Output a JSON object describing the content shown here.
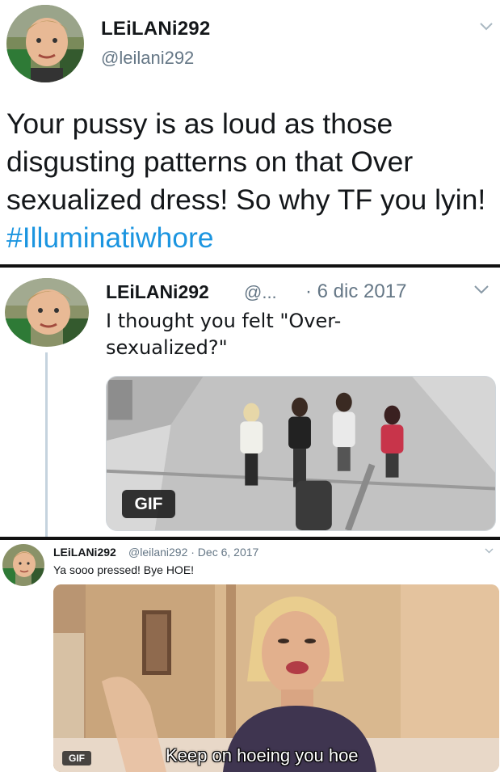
{
  "tweet1": {
    "author_name": "LEiLANi292",
    "author_handle": "@leilani292",
    "text_main": "Your pussy is as loud as those disgusting patterns on that Over sexualized dress! So why TF you lyin! ",
    "hashtag": "#Illuminatiwhore",
    "menu_icon": "chevron-down-icon",
    "avatar_icon": "avatar-child-photo"
  },
  "tweet2": {
    "author_name": "LEiLANi292",
    "author_handle": "@...",
    "date": "· 6 dic 2017",
    "text": "I thought you felt \"Over-sexualized?\"",
    "gif_badge": "GIF",
    "menu_icon": "chevron-down-icon"
  },
  "tweet3": {
    "author_name": "LEiLANi292",
    "author_handle_date": "@leilani292 · Dec 6, 2017",
    "text": "Ya sooo pressed! Bye HOE!",
    "gif_badge": "GIF",
    "gif_caption": "Keep on hoeing you hoe",
    "menu_icon": "chevron-down-icon"
  },
  "colors": {
    "hashtag": "#1b95e0",
    "secondary_text": "#657786",
    "separator": "#111111"
  }
}
